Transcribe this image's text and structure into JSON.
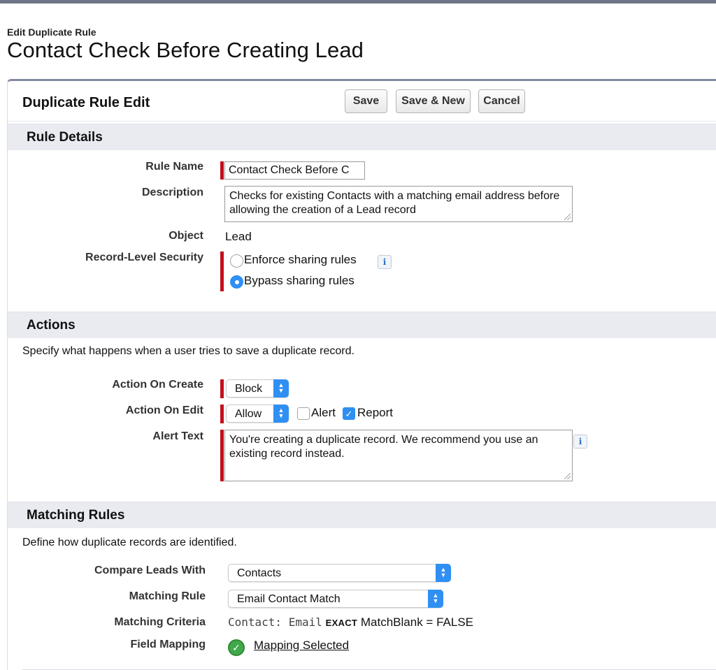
{
  "header": {
    "page_type": "Edit Duplicate Rule",
    "title": "Contact Check Before Creating Lead"
  },
  "panel": {
    "title": "Duplicate Rule Edit",
    "buttons": {
      "save": "Save",
      "save_new": "Save & New",
      "cancel": "Cancel"
    }
  },
  "rule_details": {
    "section_title": "Rule Details",
    "rule_name_label": "Rule Name",
    "rule_name_value": "Contact Check Before C",
    "description_label": "Description",
    "description_value": "Checks for existing Contacts with a matching email address before allowing the creation of a Lead record",
    "object_label": "Object",
    "object_value": "Lead",
    "security_label": "Record-Level Security",
    "security_options": [
      {
        "label": "Enforce sharing rules",
        "selected": false
      },
      {
        "label": "Bypass sharing rules",
        "selected": true
      }
    ],
    "info_glyph": "i"
  },
  "actions": {
    "section_title": "Actions",
    "intro": "Specify what happens when a user tries to save a duplicate record.",
    "on_create_label": "Action On Create",
    "on_create_value": "Block",
    "on_edit_label": "Action On Edit",
    "on_edit_value": "Allow",
    "alert_checkbox_label": "Alert",
    "alert_checked": false,
    "report_checkbox_label": "Report",
    "report_checked": true,
    "alert_text_label": "Alert Text",
    "alert_text_value": "You're creating a duplicate record. We recommend you use an existing record instead."
  },
  "matching_rules": {
    "section_title": "Matching Rules",
    "intro": "Define how duplicate records are identified.",
    "compare_label": "Compare Leads With",
    "compare_value": "Contacts",
    "rule_label": "Matching Rule",
    "rule_value": "Email Contact Match",
    "criteria_label": "Matching Criteria",
    "criteria_field": "Contact: Email",
    "criteria_operator": "EXACT",
    "criteria_rest": "MatchBlank = FALSE",
    "mapping_label": "Field Mapping",
    "mapping_link": "Mapping Selected"
  },
  "colors": {
    "accent_blue": "#2f8ff2",
    "required_red": "#c40f1c",
    "section_bg": "#e9ebf1",
    "success_green": "#41a94a"
  },
  "icons": [
    "info-icon",
    "select-arrow-icon",
    "checkmark-icon",
    "resize-grip-icon"
  ]
}
